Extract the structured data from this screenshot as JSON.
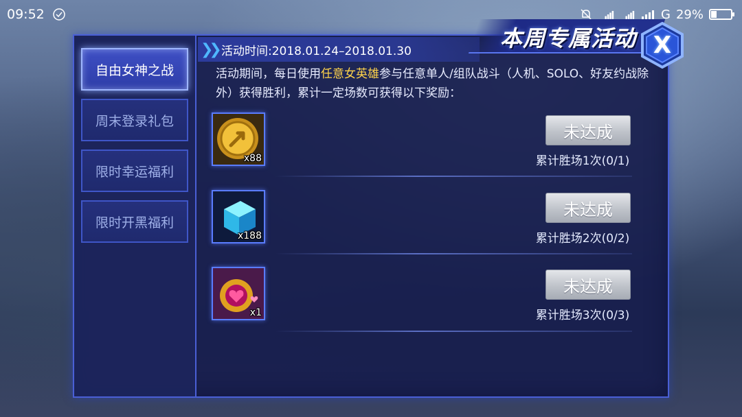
{
  "statusbar": {
    "time": "09:52",
    "network": "G",
    "battery_percent": "29%",
    "battery_level": 0.29
  },
  "sidebar": {
    "items": [
      {
        "label": "自由女神之战",
        "active": true
      },
      {
        "label": "周末登录礼包",
        "active": false
      },
      {
        "label": "限时幸运福利",
        "active": false
      },
      {
        "label": "限时开黑福利",
        "active": false
      }
    ]
  },
  "header": {
    "date_label": "活动时间:2018.01.24–2018.01.30",
    "title": "本周专属活动",
    "close_label": "X"
  },
  "description": {
    "part1": "活动期间，每日使用",
    "highlight": "任意女英雄",
    "part2": "参与任意单人/组队战斗（人机、SOLO、好友约战除外）获得胜利，累计一定场数可获得以下奖励："
  },
  "rewards": [
    {
      "icon": "gold-coin-icon",
      "quantity": "x88",
      "button": "未达成",
      "progress": "累计胜场1次(0/1)"
    },
    {
      "icon": "blue-cube-icon",
      "quantity": "x188",
      "button": "未达成",
      "progress": "累计胜场2次(0/2)"
    },
    {
      "icon": "heart-ring-icon",
      "quantity": "x1",
      "button": "未达成",
      "progress": "累计胜场3次(0/3)"
    }
  ],
  "colors": {
    "accent": "#4a5fd6",
    "highlight": "#ffd34a",
    "panel": "#181e4e"
  }
}
